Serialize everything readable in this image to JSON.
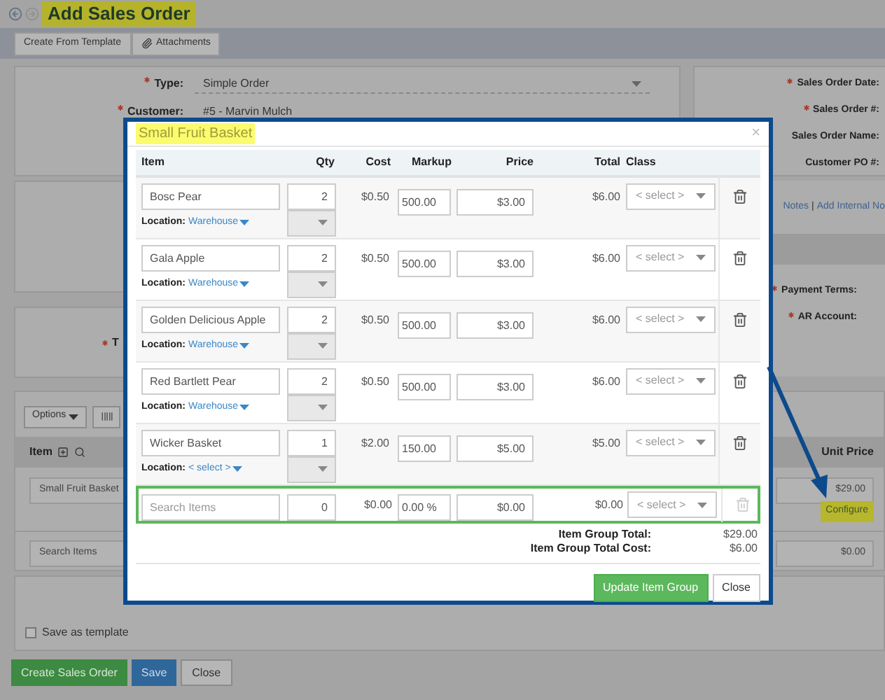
{
  "page": {
    "title": "Add Sales Order"
  },
  "toolbar": [
    {
      "label": "Create From Template",
      "kind": "plain"
    },
    {
      "label": "Attachments",
      "kind": "attach"
    }
  ],
  "left_fields": [
    {
      "label": "Type:",
      "required": true,
      "value": "Simple Order",
      "kind": "select"
    },
    {
      "label": "Customer:",
      "required": true,
      "value": "#5 - Marvin Mulch",
      "kind": "text"
    }
  ],
  "left_partial_label": {
    "label": "T",
    "required": true
  },
  "right_fields": [
    {
      "label": "Sales Order Date:",
      "required": true
    },
    {
      "label": "Sales Order #:",
      "required": true
    },
    {
      "label": "Sales Order Name:",
      "required": false
    },
    {
      "label": "Customer PO #:",
      "required": false
    }
  ],
  "notes_links": {
    "first": "Notes",
    "separator": "|",
    "second": "Add Internal No"
  },
  "right_fields_2": [
    {
      "label": "Payment Terms:",
      "required": true
    },
    {
      "label": "AR Account:",
      "required": true
    }
  ],
  "items_section": {
    "options_button": "Options",
    "item_header": "Item",
    "price_header": "Unit Price",
    "rows": [
      {
        "item": "Small Fruit Basket",
        "price": "$29.00",
        "link": "Configure",
        "kind": "item"
      },
      {
        "item": "Search Items",
        "price": "$0.00",
        "kind": "search"
      }
    ]
  },
  "save_template": {
    "label": "Save as template",
    "checked": false
  },
  "footer_buttons": [
    {
      "label": "Create Sales Order",
      "kind": "success"
    },
    {
      "label": "Save",
      "kind": "primary"
    },
    {
      "label": "Close",
      "kind": "default"
    }
  ],
  "modal": {
    "title": "Small Fruit Basket",
    "close": "×",
    "columns": [
      "Item",
      "Qty",
      "Cost",
      "Markup",
      "Price",
      "Total",
      "Class"
    ],
    "items": [
      {
        "name": "Bosc Pear",
        "qty": "2",
        "cost": "$0.50",
        "markup": "500.00",
        "price": "$3.00",
        "total": "$6.00",
        "class": "< select >",
        "location_label": "Location:",
        "location": "Warehouse"
      },
      {
        "name": "Gala Apple",
        "qty": "2",
        "cost": "$0.50",
        "markup": "500.00",
        "price": "$3.00",
        "total": "$6.00",
        "class": "< select >",
        "location_label": "Location:",
        "location": "Warehouse"
      },
      {
        "name": "Golden Delicious Apple",
        "qty": "2",
        "cost": "$0.50",
        "markup": "500.00",
        "price": "$3.00",
        "total": "$6.00",
        "class": "< select >",
        "location_label": "Location:",
        "location": "Warehouse"
      },
      {
        "name": "Red Bartlett Pear",
        "qty": "2",
        "cost": "$0.50",
        "markup": "500.00",
        "price": "$3.00",
        "total": "$6.00",
        "class": "< select >",
        "location_label": "Location:",
        "location": "Warehouse"
      },
      {
        "name": "Wicker Basket",
        "qty": "1",
        "cost": "$2.00",
        "markup": "150.00",
        "price": "$5.00",
        "total": "$5.00",
        "class": "< select >",
        "location_label": "Location:",
        "location": "< select >"
      }
    ],
    "search_row": {
      "placeholder": "Search Items",
      "qty": "0",
      "cost": "$0.00",
      "markup": "0.00 %",
      "price": "$0.00",
      "total": "$0.00",
      "class": "< select >",
      "delete_disabled": true
    },
    "totals": [
      {
        "label": "Item Group Total:",
        "value": "$29.00"
      },
      {
        "label": "Item Group Total Cost:",
        "value": "$6.00"
      }
    ],
    "buttons": [
      {
        "label": "Update Item Group",
        "kind": "success"
      },
      {
        "label": "Close",
        "kind": "default"
      }
    ]
  }
}
